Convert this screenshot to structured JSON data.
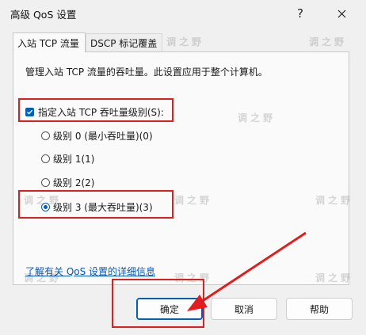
{
  "window": {
    "title": "高级 QoS 设置",
    "help_glyph": "?",
    "close_glyph": "✕"
  },
  "tabs": [
    {
      "label": "入站 TCP 流量",
      "active": true
    },
    {
      "label": "DSCP 标记覆盖",
      "active": false
    }
  ],
  "panel": {
    "description": "管理入站 TCP 流量的吞吐量。此设置应用于整个计算机。",
    "checkbox": {
      "label": "指定入站 TCP 吞吐量级别(S):",
      "checked": true
    },
    "radios": [
      {
        "label": "级别 0 (最小吞吐量)(0)",
        "checked": false
      },
      {
        "label": "级别 1(1)",
        "checked": false
      },
      {
        "label": "级别 2(2)",
        "checked": false
      },
      {
        "label": "级别 3 (最大吞吐量)(3)",
        "checked": true
      }
    ],
    "link": "了解有关 QoS 设置的详细信息"
  },
  "buttons": {
    "ok": "确定",
    "cancel": "取消",
    "help": "帮助"
  },
  "watermark_text": "调之野",
  "colors": {
    "accent": "#005fb8",
    "annotation_red": "#e11d1d",
    "link": "#0a58b6"
  }
}
